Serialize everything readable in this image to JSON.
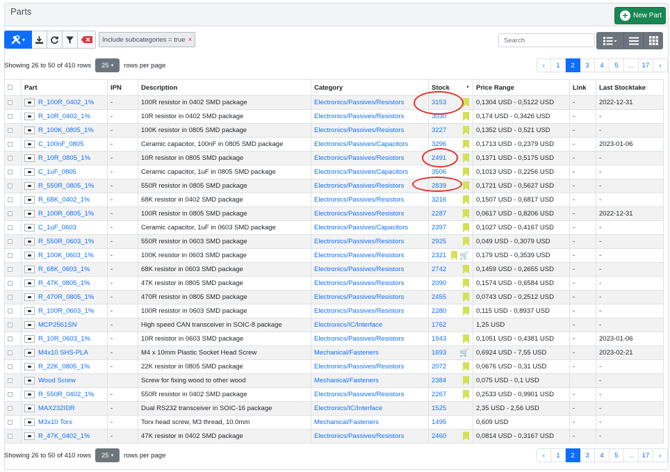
{
  "header": {
    "title": "Parts",
    "new_part_label": "New Part"
  },
  "toolbar": {
    "filter_chip": "Include subcategories = true",
    "icons": [
      "tools-icon",
      "import-icon",
      "refresh-icon",
      "filter-icon",
      "clear-filter-icon"
    ]
  },
  "search": {
    "placeholder": "Search"
  },
  "pagination_info": {
    "showing_text": "Showing 26 to 50 of 410 rows",
    "page_size": "25",
    "rows_per_page_text": "rows per page"
  },
  "pagination": {
    "prev": "‹",
    "pages": [
      "1",
      "2",
      "3",
      "4",
      "5",
      "...",
      "17"
    ],
    "active": "2",
    "next": "›"
  },
  "table": {
    "headers": [
      "Part",
      "IPN",
      "Description",
      "Category",
      "Stock",
      "Price Range",
      "Link",
      "Last Stocktake"
    ],
    "rows": [
      {
        "part": "R_100R_0402_1%",
        "ipn": "-",
        "desc": "100R resistor in 0402 SMD package",
        "cat": "Electronics/Passives/Resistors",
        "stock": "3153",
        "bookmark": true,
        "cart": false,
        "price": "0,1304 USD - 0,5122 USD",
        "link": "-",
        "stocktake": "2022-12-31"
      },
      {
        "part": "R_10R_0402_1%",
        "ipn": "-",
        "desc": "10R resistor in 0402 SMD package",
        "cat": "Electronics/Passives/Resistors",
        "stock": "3030",
        "bookmark": true,
        "cart": false,
        "price": "0,174 USD - 0,3426 USD",
        "link": "-",
        "stocktake": "-"
      },
      {
        "part": "R_100K_0805_1%",
        "ipn": "-",
        "desc": "100K resistor in 0805 SMD package",
        "cat": "Electronics/Passives/Resistors",
        "stock": "3227",
        "bookmark": true,
        "cart": false,
        "price": "0,1352 USD - 0,521 USD",
        "link": "-",
        "stocktake": "-"
      },
      {
        "part": "C_100nF_0805",
        "ipn": "-",
        "desc": "Ceramic capacitor, 100nF in 0805 SMD package",
        "cat": "Electronics/Passives/Capacitors",
        "stock": "3296",
        "bookmark": true,
        "cart": false,
        "price": "0,1713 USD - 0,2379 USD",
        "link": "-",
        "stocktake": "2023-01-06"
      },
      {
        "part": "R_10R_0805_1%",
        "ipn": "-",
        "desc": "10R resistor in 0805 SMD package",
        "cat": "Electronics/Passives/Resistors",
        "stock": "2491",
        "bookmark": true,
        "cart": false,
        "price": "0,1371 USD - 0,5175 USD",
        "link": "-",
        "stocktake": "-"
      },
      {
        "part": "C_1uF_0805",
        "ipn": "-",
        "desc": "Ceramic capacitor, 1uF in 0805 SMD package",
        "cat": "Electronics/Passives/Capacitors",
        "stock": "3506",
        "bookmark": true,
        "cart": false,
        "price": "0,1013 USD - 0,2256 USD",
        "link": "-",
        "stocktake": "-"
      },
      {
        "part": "R_550R_0805_1%",
        "ipn": "-",
        "desc": "550R resistor in 0805 SMD package",
        "cat": "Electronics/Passives/Resistors",
        "stock": "2839",
        "bookmark": true,
        "cart": false,
        "price": "0,1721 USD - 0,5627 USD",
        "link": "-",
        "stocktake": "-"
      },
      {
        "part": "R_68K_0402_1%",
        "ipn": "-",
        "desc": "68K resistor in 0402 SMD package",
        "cat": "Electronics/Passives/Resistors",
        "stock": "3216",
        "bookmark": true,
        "cart": false,
        "price": "0,1507 USD - 0,6817 USD",
        "link": "-",
        "stocktake": "-"
      },
      {
        "part": "R_100R_0805_1%",
        "ipn": "-",
        "desc": "100R resistor in 0805 SMD package",
        "cat": "Electronics/Passives/Resistors",
        "stock": "2287",
        "bookmark": true,
        "cart": false,
        "price": "0,0617 USD - 0,8206 USD",
        "link": "-",
        "stocktake": "2022-12-31"
      },
      {
        "part": "C_1uF_0603",
        "ipn": "-",
        "desc": "Ceramic capacitor, 1uF in 0603 SMD package",
        "cat": "Electronics/Passives/Capacitors",
        "stock": "2397",
        "bookmark": true,
        "cart": false,
        "price": "0,1027 USD - 0,4167 USD",
        "link": "-",
        "stocktake": "-"
      },
      {
        "part": "R_550R_0603_1%",
        "ipn": "-",
        "desc": "550R resistor in 0603 SMD package",
        "cat": "Electronics/Passives/Resistors",
        "stock": "2925",
        "bookmark": true,
        "cart": false,
        "price": "0,049 USD - 0,3079 USD",
        "link": "-",
        "stocktake": "-"
      },
      {
        "part": "R_100K_0603_1%",
        "ipn": "-",
        "desc": "100K resistor in 0603 SMD package",
        "cat": "Electronics/Passives/Resistors",
        "stock": "2321",
        "bookmark": true,
        "cart": true,
        "price": "0,179 USD - 0,3539 USD",
        "link": "-",
        "stocktake": "-"
      },
      {
        "part": "R_68K_0603_1%",
        "ipn": "-",
        "desc": "68K resistor in 0603 SMD package",
        "cat": "Electronics/Passives/Resistors",
        "stock": "2742",
        "bookmark": true,
        "cart": false,
        "price": "0,1459 USD - 0,2655 USD",
        "link": "-",
        "stocktake": "-"
      },
      {
        "part": "R_47K_0805_1%",
        "ipn": "-",
        "desc": "47K resistor in 0805 SMD package",
        "cat": "Electronics/Passives/Resistors",
        "stock": "2090",
        "bookmark": true,
        "cart": false,
        "price": "0,1574 USD - 0,6584 USD",
        "link": "-",
        "stocktake": "-"
      },
      {
        "part": "R_470R_0805_1%",
        "ipn": "-",
        "desc": "470R resistor in 0805 SMD package",
        "cat": "Electronics/Passives/Resistors",
        "stock": "2455",
        "bookmark": true,
        "cart": false,
        "price": "0,0743 USD - 0,2512 USD",
        "link": "-",
        "stocktake": "-"
      },
      {
        "part": "R_100R_0603_1%",
        "ipn": "-",
        "desc": "100R resistor in 0603 SMD package",
        "cat": "Electronics/Passives/Resistors",
        "stock": "2280",
        "bookmark": true,
        "cart": false,
        "price": "0,115 USD - 0,8937 USD",
        "link": "-",
        "stocktake": "-"
      },
      {
        "part": "MCP2561SN",
        "ipn": "-",
        "desc": "High speed CAN transceiver in SOIC-8 package",
        "cat": "Electronics/IC/Interface",
        "stock": "1762",
        "bookmark": false,
        "cart": false,
        "price": "1,25 USD",
        "link": "-",
        "stocktake": "-"
      },
      {
        "part": "R_10R_0603_1%",
        "ipn": "-",
        "desc": "10R resistor in 0603 SMD package",
        "cat": "Electronics/Passives/Resistors",
        "stock": "1943",
        "bookmark": true,
        "cart": false,
        "price": "0,1051 USD - 0,4381 USD",
        "link": "-",
        "stocktake": "2023-01-06"
      },
      {
        "part": "M4x10 SHS-PLA",
        "ipn": "-",
        "desc": "M4 x 10mm Plastic Socket Head Screw",
        "cat": "Mechanical/Fasteners",
        "stock": "1693",
        "bookmark": false,
        "cart": true,
        "price": "0,6924 USD - 7,55 USD",
        "link": "-",
        "stocktake": "2023-02-21"
      },
      {
        "part": "R_22K_0805_1%",
        "ipn": "-",
        "desc": "22K resistor in 0805 SMD package",
        "cat": "Electronics/Passives/Resistors",
        "stock": "2072",
        "bookmark": true,
        "cart": false,
        "price": "0,0676 USD - 0,31 USD",
        "link": "-",
        "stocktake": "-"
      },
      {
        "part": "Wood Screw",
        "ipn": "",
        "desc": "Screw for fixing wood to other wood",
        "cat": "Mechanical/Fasteners",
        "stock": "2384",
        "bookmark": true,
        "cart": false,
        "price": "0,075 USD - 0,1 USD",
        "link": "",
        "stocktake": "-"
      },
      {
        "part": "R_550R_0402_1%",
        "ipn": "-",
        "desc": "550R resistor in 0402 SMD package",
        "cat": "Electronics/Passives/Resistors",
        "stock": "2267",
        "bookmark": true,
        "cart": false,
        "price": "0,2533 USD - 0,9901 USD",
        "link": "-",
        "stocktake": "-"
      },
      {
        "part": "MAX232IDR",
        "ipn": "-",
        "desc": "Dual RS232 transceiver in SOIC-16 package",
        "cat": "Electronics/IC/Interface",
        "stock": "1525",
        "bookmark": false,
        "cart": false,
        "price": "2,35 USD - 2,56 USD",
        "link": "-",
        "stocktake": "-"
      },
      {
        "part": "M3x10 Torx",
        "ipn": "-",
        "desc": "Torx head screw, M3 thread, 10.0mm",
        "cat": "Mechanical/Fasteners",
        "stock": "1495",
        "bookmark": false,
        "cart": false,
        "price": "0,609 USD",
        "link": "-",
        "stocktake": "-"
      },
      {
        "part": "R_47K_0402_1%",
        "ipn": "-",
        "desc": "47K resistor in 0402 SMD package",
        "cat": "Electronics/Passives/Resistors",
        "stock": "2460",
        "bookmark": true,
        "cart": false,
        "price": "0,0814 USD - 0,3167 USD",
        "link": "-",
        "stocktake": "-"
      }
    ]
  },
  "colors": {
    "accent": "#0d6efd",
    "success": "#198754",
    "bookmark": "#d4e157",
    "annotation": "#e0302a"
  }
}
